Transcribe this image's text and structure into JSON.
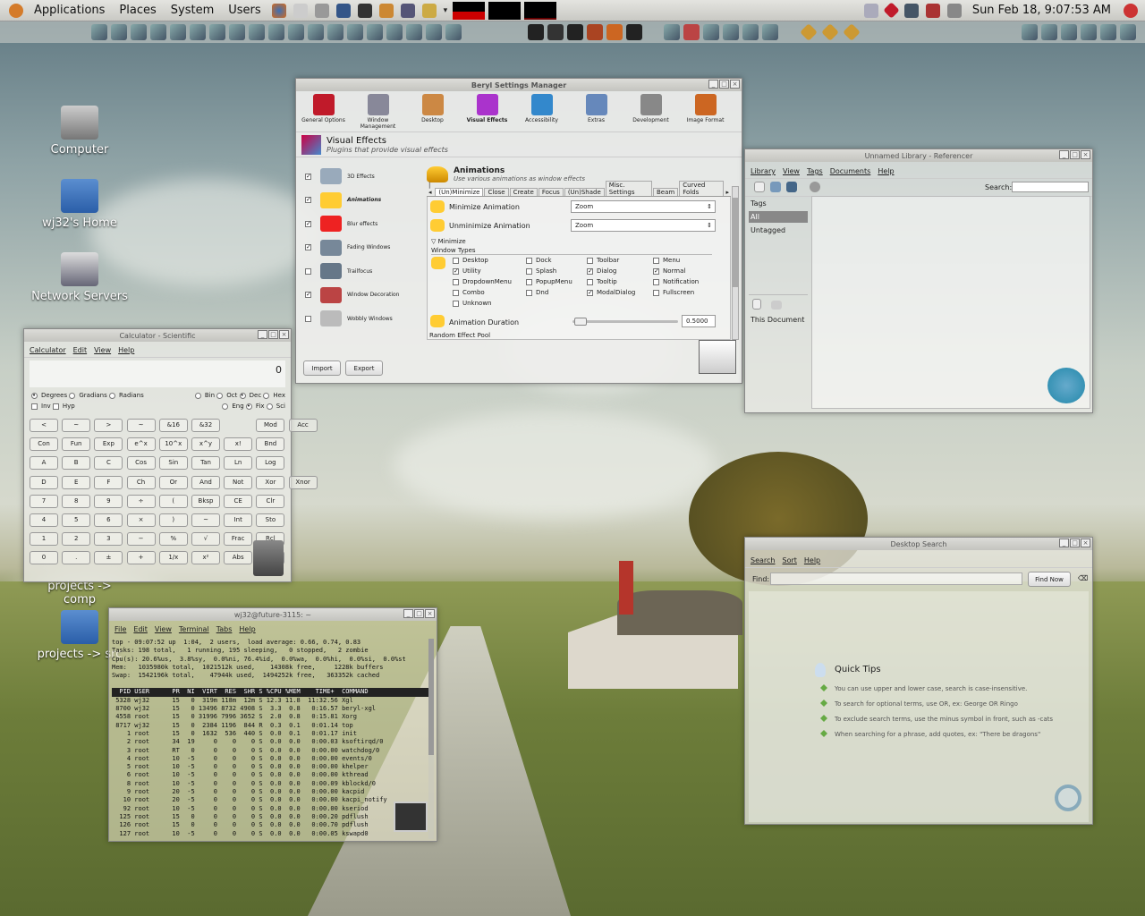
{
  "panel": {
    "menus": [
      "Applications",
      "Places",
      "System",
      "Users"
    ],
    "clock": "Sun Feb 18,  9:07:53 AM"
  },
  "desktop": {
    "icons": [
      "Computer",
      "wj32's Home",
      "Network Servers",
      "projects -> comp",
      "projects -> src"
    ]
  },
  "beryl": {
    "title": "Beryl Settings Manager",
    "categories": [
      "General Options",
      "Window Management",
      "Desktop",
      "Visual Effects",
      "Accessibility",
      "Extras",
      "Development",
      "Image Format"
    ],
    "header_title": "Visual Effects",
    "header_sub": "Plugins that provide visual effects",
    "plugins": [
      "3D Effects",
      "Animations",
      "Blur effects",
      "Fading Windows",
      "Trailfocus",
      "Window Decoration",
      "Wobbly Windows"
    ],
    "plugin_checked": [
      true,
      true,
      true,
      true,
      false,
      true,
      false
    ],
    "anim_title": "Animations",
    "anim_sub": "Use various animations as window effects",
    "tabs": [
      "(Un)Minimize",
      "Close",
      "Create",
      "Focus",
      "(Un)Shade",
      "Misc. Settings",
      "Beam",
      "Curved Folds"
    ],
    "min_label": "Minimize Animation",
    "min_value": "Zoom",
    "unmin_label": "Unminimize Animation",
    "unmin_value": "Zoom",
    "section": "Minimize",
    "wtypes": "Window Types",
    "types": [
      "Desktop",
      "Dock",
      "Toolbar",
      "Menu",
      "Utility",
      "Splash",
      "Dialog",
      "Normal",
      "DropdownMenu",
      "PopupMenu",
      "Tooltip",
      "Notification",
      "Combo",
      "Dnd",
      "ModalDialog",
      "Fullscreen",
      "Unknown"
    ],
    "types_checked": [
      false,
      false,
      false,
      false,
      true,
      false,
      true,
      true,
      false,
      false,
      false,
      false,
      false,
      false,
      true,
      false,
      false
    ],
    "duration_label": "Animation Duration",
    "duration_value": "0.5000",
    "random": "Random Effect Pool",
    "import": "Import",
    "export": "Export"
  },
  "library": {
    "title": "Unnamed Library - Referencer",
    "menus": [
      "Library",
      "View",
      "Tags",
      "Documents",
      "Help"
    ],
    "search": "Search:",
    "tags": "Tags",
    "all": "All",
    "untagged": "Untagged",
    "this_doc": "This Document"
  },
  "calc": {
    "title": "Calculator - Scientific",
    "menus": [
      "Calculator",
      "Edit",
      "View",
      "Help"
    ],
    "display": "0",
    "angle": [
      "Degrees",
      "Gradians",
      "Radians"
    ],
    "base": [
      "Bin",
      "Oct",
      "Dec",
      "Hex"
    ],
    "inv": "Inv",
    "hyp": "Hyp",
    "fmt": [
      "Eng",
      "Fix",
      "Sci"
    ],
    "rows": [
      [
        "<",
        "~",
        ">",
        "~",
        "&16",
        "&32",
        "",
        "Mod",
        "Acc"
      ],
      [
        "Con",
        "Fun",
        "Exp",
        "e^x",
        "10^x",
        "x^y",
        "x!",
        "Bnd"
      ],
      [
        "A",
        "B",
        "C",
        "Cos",
        "Sin",
        "Tan",
        "Ln",
        "Log"
      ],
      [
        "D",
        "E",
        "F",
        "Ch",
        "Or",
        "And",
        "Not",
        "Xor",
        "Xnor"
      ],
      [
        "7",
        "8",
        "9",
        "÷",
        "(",
        "Bksp",
        "CE",
        "Clr"
      ],
      [
        "4",
        "5",
        "6",
        "×",
        ")",
        "~",
        "Int",
        "Sto"
      ],
      [
        "1",
        "2",
        "3",
        "−",
        "%",
        "√",
        "Frac",
        "Rcl"
      ],
      [
        "0",
        ".",
        "±",
        "+",
        "1/x",
        "x²",
        "Abs",
        "="
      ]
    ]
  },
  "terminal": {
    "title": "wj32@future-3115: ~",
    "menus": [
      "File",
      "Edit",
      "View",
      "Terminal",
      "Tabs",
      "Help"
    ],
    "lines": [
      "top - 09:07:52 up  1:04,  2 users,  load average: 0.66, 0.74, 0.83",
      "Tasks: 198 total,   1 running, 195 sleeping,   0 stopped,   2 zombie",
      "Cpu(s): 20.6%us,  3.8%sy,  0.0%ni, 76.4%id,  0.0%wa,  0.0%hi,  0.0%si,  0.0%st",
      "Mem:   1035980k total,  1021512k used,    14308k free,     1228k buffers",
      "Swap:  1542196k total,    47944k used,  1494252k free,   363352k cached"
    ],
    "header": "  PID USER      PR  NI  VIRT  RES  SHR S %CPU %MEM    TIME+  COMMAND",
    "rows": [
      " 5328 wj32      15   0  319m 118m  12m S 12.3 11.8  11:32.56 Xgl",
      " 8700 wj32      15   0 13496 8732 4908 S  3.3  0.8   0:16.57 beryl-xgl",
      " 4558 root      15   0 31996 7996 3652 S  2.0  0.8   0:15.81 Xorg",
      " 8717 wj32      15   0  2384 1196  844 R  0.3  0.1   0:01.14 top",
      "    1 root      15   0  1632  536  440 S  0.0  0.1   0:01.17 init",
      "    2 root      34  19     0    0    0 S  0.0  0.0   0:00.03 ksoftirqd/0",
      "    3 root      RT   0     0    0    0 S  0.0  0.0   0:00.00 watchdog/0",
      "    4 root      10  -5     0    0    0 S  0.0  0.0   0:00.00 events/0",
      "    5 root      10  -5     0    0    0 S  0.0  0.0   0:00.00 khelper",
      "    6 root      10  -5     0    0    0 S  0.0  0.0   0:00.00 kthread",
      "    8 root      10  -5     0    0    0 S  0.0  0.0   0:00.09 kblockd/0",
      "    9 root      20  -5     0    0    0 S  0.0  0.0   0:00.00 kacpid",
      "   10 root      20  -5     0    0    0 S  0.0  0.0   0:00.00 kacpi_notify",
      "   92 root      10  -5     0    0    0 S  0.0  0.0   0:00.00 kseriod",
      "  125 root      15   0     0    0    0 S  0.0  0.0   0:00.20 pdflush",
      "  126 root      15   0     0    0    0 S  0.0  0.0   0:00.70 pdflush",
      "  127 root      10  -5     0    0    0 S  0.0  0.0   0:00.05 kswapd0"
    ]
  },
  "search": {
    "title": "Desktop Search",
    "menus": [
      "Search",
      "Sort",
      "Help"
    ],
    "find": "Find:",
    "find_btn": "Find Now",
    "tips_title": "Quick Tips",
    "tips": [
      "You can use upper and lower case, search is case-insensitive.",
      "To search for optional terms, use OR, ex: George OR Ringo",
      "To exclude search terms, use the minus symbol in front, such as -cats",
      "When searching for a phrase, add quotes, ex: \"There be dragons\""
    ]
  }
}
